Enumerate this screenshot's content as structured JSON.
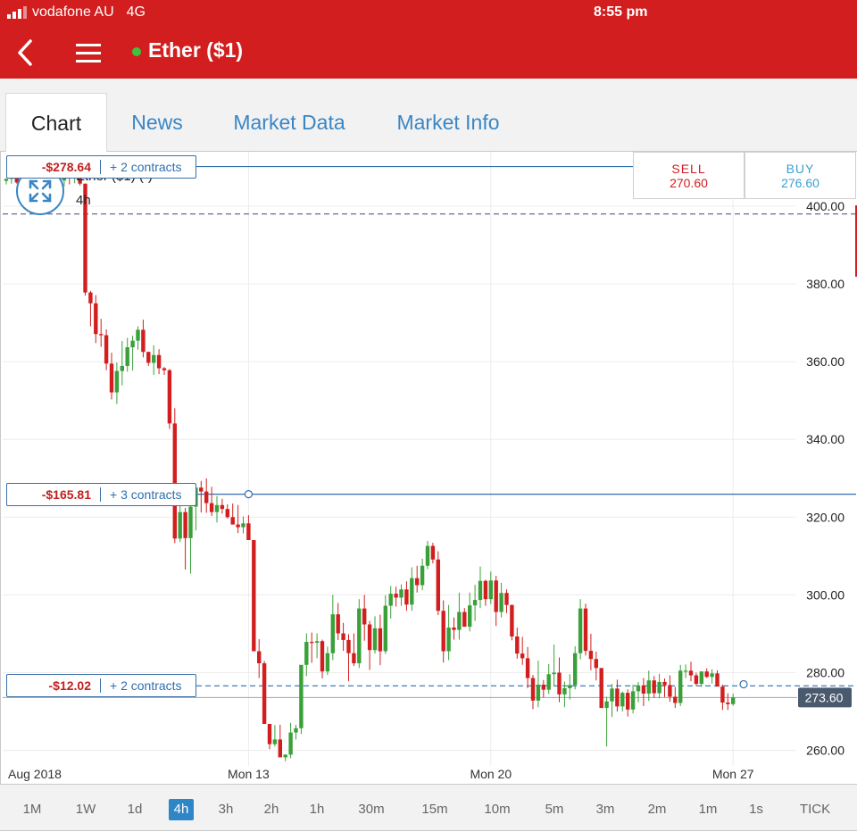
{
  "status_bar": {
    "carrier": "vodafone AU",
    "network": "4G",
    "time": "8:55 pm"
  },
  "nav": {
    "title": "Ether ($1)",
    "back_icon": "chevron-left-icon",
    "menu_icon": "hamburger-icon"
  },
  "tabs": [
    {
      "label": "Chart",
      "active": true
    },
    {
      "label": "News",
      "active": false
    },
    {
      "label": "Market Data",
      "active": false
    },
    {
      "label": "Market Info",
      "active": false
    }
  ],
  "instrument": {
    "name": "Ether ($1) (-)",
    "timeframe": "4h"
  },
  "quote": {
    "sell_label": "SELL",
    "sell_price": "270.60",
    "buy_label": "BUY",
    "buy_price": "276.60"
  },
  "positions": [
    {
      "pnl": "-$278.64",
      "contracts": "+ 2 contracts",
      "level": 410.2
    },
    {
      "pnl": "-$165.81",
      "contracts": "+ 3 contracts",
      "level": 325.9
    },
    {
      "pnl": "-$12.02",
      "contracts": "+ 2 contracts",
      "level": 276.6
    }
  ],
  "timeframes": [
    {
      "label": "1M",
      "active": false
    },
    {
      "label": "1W",
      "active": false
    },
    {
      "label": "1d",
      "active": false
    },
    {
      "label": "4h",
      "active": true
    },
    {
      "label": "3h",
      "active": false
    },
    {
      "label": "2h",
      "active": false
    },
    {
      "label": "1h",
      "active": false
    },
    {
      "label": "30m",
      "active": false
    },
    {
      "label": "15m",
      "active": false
    },
    {
      "label": "10m",
      "active": false
    },
    {
      "label": "5m",
      "active": false
    },
    {
      "label": "3m",
      "active": false
    },
    {
      "label": "2m",
      "active": false
    },
    {
      "label": "1m",
      "active": false
    },
    {
      "label": "1s",
      "active": false
    },
    {
      "label": "TICK",
      "active": false
    }
  ],
  "colors": {
    "brand": "#d21e1e",
    "up": "#3aa03a",
    "down": "#d21e1e",
    "link": "#3a86c4",
    "price_tag": "#4a5a6e"
  },
  "chart_data": {
    "type": "candlestick",
    "ylim": [
      256,
      414
    ],
    "yticks": [
      "400.00",
      "380.00",
      "360.00",
      "340.00",
      "320.00",
      "300.00",
      "280.00",
      "260.00"
    ],
    "ytick_values": [
      400,
      380,
      360,
      340,
      320,
      300,
      280,
      260
    ],
    "xticks": [
      "Aug 2018",
      "Mon 13",
      "Mon 20",
      "Mon 27"
    ],
    "xtick_index": [
      0,
      46,
      92,
      138
    ],
    "reference_line": 398,
    "current_price": "273.60",
    "current_value": 273.6,
    "candles": [
      [
        406.5,
        407.2,
        405.6,
        407
      ],
      [
        407,
        408.9,
        405.8,
        408.3
      ],
      [
        408.3,
        409.2,
        405.8,
        406.1
      ],
      [
        406.1,
        409.1,
        405.4,
        408.1
      ],
      [
        408.1,
        409.8,
        406.3,
        406.9
      ],
      [
        406.9,
        410.5,
        405.9,
        409.6
      ],
      [
        409.6,
        411.1,
        407.7,
        408.8
      ],
      [
        408.8,
        409.3,
        405,
        406.9
      ],
      [
        406.9,
        408.9,
        403.8,
        404.3
      ],
      [
        404.3,
        406.5,
        401.7,
        402.9
      ],
      [
        402.9,
        407.4,
        401.9,
        406.6
      ],
      [
        406.6,
        408.9,
        405.1,
        407.8
      ],
      [
        407.8,
        409.8,
        405.6,
        407.6
      ],
      [
        407.6,
        410.3,
        405.9,
        408.8
      ],
      [
        408.8,
        409.4,
        405.3,
        405.8
      ],
      [
        405.8,
        405.8,
        377,
        377.8
      ],
      [
        377.8,
        378.2,
        369.1,
        375
      ],
      [
        375,
        377.1,
        364.8,
        367.1
      ],
      [
        367.1,
        371,
        363.8,
        366.8
      ],
      [
        366.8,
        368.3,
        357.8,
        359.5
      ],
      [
        359.5,
        362.3,
        350.3,
        352.1
      ],
      [
        352.1,
        359.8,
        349.1,
        357.6
      ],
      [
        357.6,
        365.3,
        353.9,
        358.9
      ],
      [
        358.9,
        366.1,
        357.4,
        363.7
      ],
      [
        363.7,
        366.7,
        357.7,
        365.4
      ],
      [
        365.4,
        369.1,
        363.1,
        368.2
      ],
      [
        368.2,
        370.8,
        361.1,
        362.5
      ],
      [
        362.5,
        362.6,
        358.9,
        359.7
      ],
      [
        359.7,
        364.2,
        356.6,
        361.7
      ],
      [
        361.7,
        363.2,
        356.8,
        358.3
      ],
      [
        358.3,
        358.6,
        356.6,
        357.8
      ],
      [
        357.8,
        358.1,
        342.7,
        344.1
      ],
      [
        344.1,
        348,
        313.3,
        314.5
      ],
      [
        314.5,
        323.8,
        313.6,
        321.3
      ],
      [
        321.3,
        322.4,
        306.5,
        314.6
      ],
      [
        314.6,
        324.4,
        305.5,
        322.7
      ],
      [
        322.7,
        328.4,
        316.6,
        327.6
      ],
      [
        327.6,
        329.3,
        321.2,
        326.6
      ],
      [
        326.6,
        330,
        321.1,
        323.6
      ],
      [
        323.6,
        327.8,
        320.3,
        321.3
      ],
      [
        321.3,
        325.4,
        318.6,
        323.1
      ],
      [
        323.1,
        324.7,
        320.9,
        322.1
      ],
      [
        322.1,
        323.3,
        319.6,
        320
      ],
      [
        320,
        323.5,
        318.3,
        318.1
      ],
      [
        318.1,
        323.1,
        315.9,
        317.4
      ],
      [
        317.4,
        320.2,
        315.8,
        318.4
      ],
      [
        318.4,
        320.5,
        314.3,
        314.1
      ],
      [
        314.1,
        314.1,
        286.5,
        285.5
      ],
      [
        285.5,
        288.6,
        278.6,
        282.4
      ],
      [
        282.4,
        283,
        271.2,
        266.8
      ],
      [
        266.8,
        266.7,
        260.3,
        261.6
      ],
      [
        261.6,
        266.5,
        261,
        262.8
      ],
      [
        262.8,
        266.6,
        259.4,
        258.2
      ],
      [
        258.2,
        259,
        257.2,
        258.9
      ],
      [
        258.9,
        267.1,
        258,
        264.6
      ],
      [
        264.6,
        266.6,
        262.8,
        265.7
      ],
      [
        265.7,
        277.9,
        264.2,
        282
      ],
      [
        282,
        290.1,
        279.1,
        287.9
      ],
      [
        287.9,
        290.3,
        282.5,
        287.7
      ],
      [
        287.7,
        290.1,
        283.7,
        288.1
      ],
      [
        288.1,
        288.5,
        278.5,
        280.3
      ],
      [
        280.3,
        286.7,
        279.4,
        285
      ],
      [
        285,
        300,
        283.2,
        295
      ],
      [
        295,
        297.9,
        288.4,
        290.1
      ],
      [
        290.1,
        292.8,
        285.6,
        288.4
      ],
      [
        288.4,
        289.9,
        277.8,
        285
      ],
      [
        285,
        290.1,
        281.7,
        282.4
      ],
      [
        282.4,
        298.9,
        281.2,
        296.5
      ],
      [
        296.5,
        300,
        288.2,
        292.4
      ],
      [
        292.4,
        293.3,
        280.7,
        285.8
      ],
      [
        285.8,
        294.5,
        284.9,
        291.4
      ],
      [
        291.4,
        294.9,
        281.9,
        285.5
      ],
      [
        285.5,
        299.9,
        284.8,
        297.2
      ],
      [
        297.2,
        302.3,
        293.9,
        300.3
      ],
      [
        300.3,
        302.1,
        297,
        299.3
      ],
      [
        299.3,
        302.7,
        297.2,
        301.4
      ],
      [
        301.4,
        303.5,
        295.9,
        297.5
      ],
      [
        297.5,
        307.1,
        295.9,
        304.3
      ],
      [
        304.3,
        307.5,
        300.6,
        302.5
      ],
      [
        302.5,
        309.3,
        301.2,
        307.5
      ],
      [
        307.5,
        313.9,
        306.6,
        312.6
      ],
      [
        312.6,
        313.4,
        308.1,
        309.1
      ],
      [
        309.1,
        311.2,
        294.8,
        295.9
      ],
      [
        295.9,
        298.6,
        282.6,
        285.5
      ],
      [
        285.5,
        297.4,
        283.2,
        291.6
      ],
      [
        291.6,
        294.2,
        288.5,
        291
      ],
      [
        291,
        300.6,
        288.5,
        295.6
      ],
      [
        295.6,
        296.6,
        292.9,
        291.8
      ],
      [
        291.8,
        300.6,
        290.6,
        297.3
      ],
      [
        297.3,
        302.6,
        293.3,
        298.7
      ],
      [
        298.7,
        307.3,
        296.6,
        303.6
      ],
      [
        303.6,
        303.9,
        297.2,
        298.9
      ],
      [
        298.9,
        306,
        297.6,
        303.7
      ],
      [
        303.7,
        304.9,
        292,
        295.6
      ],
      [
        295.6,
        303.1,
        294.2,
        300.5
      ],
      [
        300.5,
        301.4,
        295.3,
        297.4
      ],
      [
        297.4,
        297.5,
        288.3,
        289.3
      ],
      [
        289.3,
        291.6,
        283.6,
        284.9
      ],
      [
        284.9,
        289.2,
        282,
        283.7
      ],
      [
        283.7,
        286.6,
        276,
        278.6
      ],
      [
        278.6,
        279.4,
        270.6,
        272.8
      ],
      [
        272.8,
        283.1,
        271.1,
        276.9
      ],
      [
        276.9,
        278.1,
        273.6,
        275.6
      ],
      [
        275.6,
        282.2,
        274.5,
        279.6
      ],
      [
        279.6,
        287.2,
        276.5,
        280
      ],
      [
        280,
        283.9,
        272.4,
        274.4
      ],
      [
        274.4,
        277.7,
        271.1,
        276
      ],
      [
        276,
        279.6,
        273.1,
        276.8
      ],
      [
        276.8,
        286.8,
        275.7,
        285
      ],
      [
        285,
        298.9,
        283.4,
        296.5
      ],
      [
        296.5,
        297.7,
        284.4,
        285.6
      ],
      [
        285.6,
        290,
        280.6,
        283.5
      ],
      [
        283.5,
        285.4,
        278,
        281.2
      ],
      [
        281.2,
        281.1,
        272,
        270.9
      ],
      [
        270.9,
        273.8,
        261,
        272.6
      ],
      [
        272.6,
        277.1,
        268.6,
        275.9
      ],
      [
        275.9,
        278.2,
        270,
        271.3
      ],
      [
        271.3,
        275.1,
        270,
        274.8
      ],
      [
        274.8,
        275.7,
        268.7,
        270.5
      ],
      [
        270.5,
        276.9,
        269.5,
        275.2
      ],
      [
        275.2,
        277.6,
        272.4,
        276.7
      ],
      [
        276.7,
        278.6,
        271.4,
        274.6
      ],
      [
        274.6,
        280.5,
        272.7,
        278
      ],
      [
        278,
        279.1,
        273.5,
        274.7
      ],
      [
        274.7,
        279.7,
        273.4,
        277.6
      ],
      [
        277.6,
        278.5,
        273.7,
        276.8
      ],
      [
        276.8,
        279.3,
        272.5,
        273.8
      ],
      [
        273.8,
        276.3,
        270.9,
        272.2
      ],
      [
        272.2,
        282,
        271.4,
        280.5
      ],
      [
        280.5,
        282.1,
        278.6,
        280.5
      ],
      [
        280.5,
        282.8,
        277.8,
        279.3
      ],
      [
        279.3,
        280,
        276.6,
        277.1
      ],
      [
        277.1,
        280.3,
        276.3,
        280.3
      ],
      [
        280.3,
        281.1,
        278.6,
        278.9
      ],
      [
        278.9,
        280.9,
        277.2,
        279.8
      ],
      [
        279.8,
        280.6,
        276.7,
        276.4
      ],
      [
        276.4,
        276.9,
        270.4,
        272.3
      ],
      [
        272.3,
        274.7,
        270.4,
        271.9
      ],
      [
        271.9,
        274.6,
        271.5,
        273.6
      ]
    ]
  }
}
